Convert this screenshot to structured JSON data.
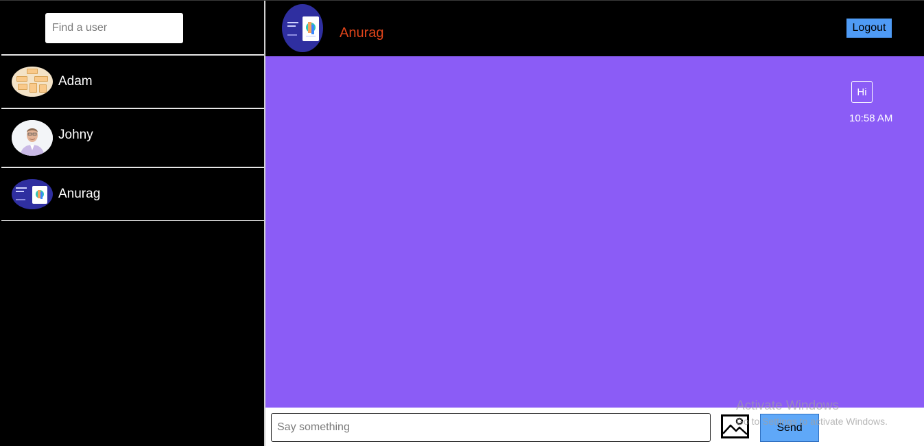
{
  "sidebar": {
    "search": {
      "placeholder": "Find a user",
      "value": ""
    },
    "users": [
      {
        "name": "Adam",
        "avatar": "sticky-notes-photo"
      },
      {
        "name": "Johny",
        "avatar": "man-portrait-photo"
      },
      {
        "name": "Anurag",
        "avatar": "blue-slide-thumbnail"
      }
    ]
  },
  "header": {
    "name": "Anurag",
    "name_color": "#e0441a",
    "avatar": "blue-slide-thumbnail",
    "logout_label": "Logout"
  },
  "messages": [
    {
      "text": "Hi",
      "time": "10:58 AM",
      "sender": "self"
    }
  ],
  "composer": {
    "placeholder": "Say something",
    "value": "",
    "image_icon": "image-icon",
    "send_label": "Send"
  },
  "watermark": {
    "title": "Activate Windows",
    "subtitle": "Go to Settings to activate Windows."
  },
  "colors": {
    "background": "#000000",
    "chat_area": "#8b5cf6",
    "accent_button": "#4f9bf5"
  }
}
